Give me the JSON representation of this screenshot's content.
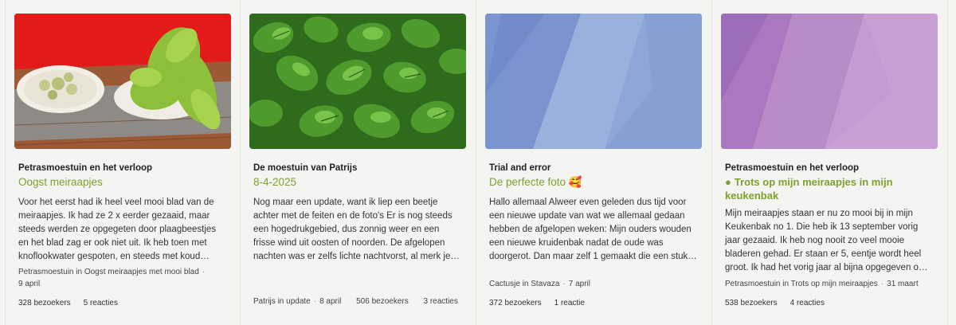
{
  "cards": [
    {
      "blog": "Petrasmoestuin en het verloop",
      "title": "Oogst meiraapjes",
      "excerpt": "Voor het eerst had ik heel veel mooi blad van de meiraapjes. Ik had ze 2 x eerder gezaaid, maar steeds werden ze opgegeten door plaagbeestjes en het blad zag er ook niet uit. Ik heb toen met knoflookwater gespoten, en steeds met koud…",
      "author": "Petrasmoestuin",
      "in_word": "in",
      "category": "Oogst meiraapjes met mooi blad",
      "date": "9 april",
      "visitors": "328 bezoekers",
      "reactions": "5 reacties",
      "image": "radish-harvest-photo"
    },
    {
      "blog": "De moestuin van Patrijs",
      "title": "8-4-2025",
      "excerpt": "Nog maar een update, want ik liep een beetje achter met de feiten en de foto's   Er is nog steeds een hogedrukgebied, dus zonnig weer en een frisse wind uit oosten of noorden. De afgelopen nachten was er zelfs lichte nachtvorst, al merk je…",
      "author": "Patrijs",
      "in_word": "in",
      "category": "update",
      "date": "8 april",
      "visitors": "506 bezoekers",
      "reactions": "3 reacties",
      "image": "spinach-leaves-photo"
    },
    {
      "blog": "Trial and error",
      "title": "De perfecte foto",
      "title_emoji": "🥰",
      "excerpt": "Hallo allemaal   Alweer even geleden dus tijd voor een nieuwe update van wat we allemaal gedaan hebben de afgelopen weken: Mijn ouders wouden een nieuwe kruidenbak nadat de oude was doorgerot. Dan maar zelf 1 gemaakt die een stuk…",
      "author": "Cactusje",
      "in_word": "in",
      "category": "Stavaza",
      "date": "7 april",
      "visitors": "372 bezoekers",
      "reactions": "1 reactie",
      "image": "blue-placeholder"
    },
    {
      "blog": "Petrasmoestuin en het verloop",
      "title": "Trots op mijn meiraapjes in mijn keukenbak",
      "title_prefix": "●",
      "excerpt": "Mijn meiraapjes staan er nu zo mooi bij in mijn Keukenbak no 1. Die heb ik 13 september vorig jaar gezaaid. Ik heb nog nooit zo veel mooie bladeren gehad. Er staan er 5, eentje wordt heel groot. Ik had het vorig jaar al bijna opgegeven o…",
      "author": "Petrasmoestuin",
      "in_word": "in",
      "category": "Trots op mijn meiraapjes",
      "date": "31 maart",
      "visitors": "538 bezoekers",
      "reactions": "4 reacties",
      "image": "purple-placeholder"
    }
  ],
  "colors": {
    "title_green": "#7ea12e",
    "blue_placeholder": "#8ea6d8",
    "purple_placeholder": "#b98bc9"
  }
}
